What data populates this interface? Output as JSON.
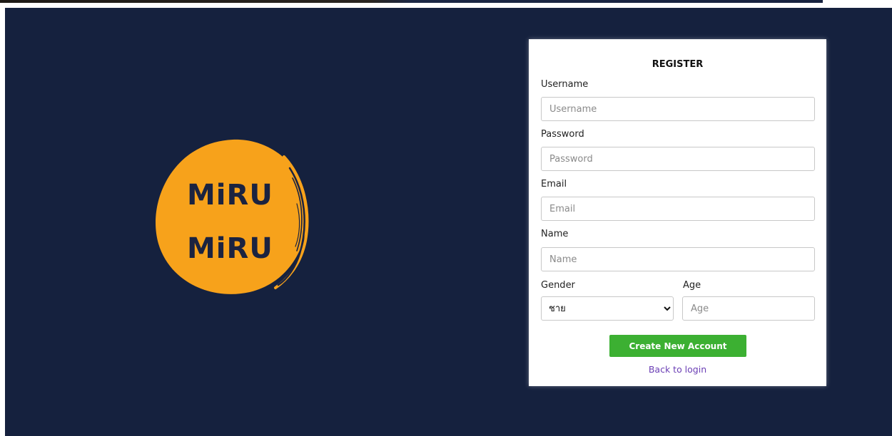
{
  "logo": {
    "line1": "MiRU",
    "line2": "MiRU",
    "color": "#f7a21b",
    "text_color": "#1b2340"
  },
  "form": {
    "title": "REGISTER",
    "username": {
      "label": "Username",
      "placeholder": "Username",
      "value": ""
    },
    "password": {
      "label": "Password",
      "placeholder": "Password",
      "value": ""
    },
    "email": {
      "label": "Email",
      "placeholder": "Email",
      "value": ""
    },
    "name": {
      "label": "Name",
      "placeholder": "Name",
      "value": ""
    },
    "gender": {
      "label": "Gender",
      "selected": "ชาย"
    },
    "age": {
      "label": "Age",
      "placeholder": "Age",
      "value": ""
    },
    "submit_label": "Create New Account",
    "back_link": "Back to login"
  },
  "colors": {
    "background": "#15213e",
    "card": "#ffffff",
    "button": "#3cb032",
    "link": "#6b3fb5"
  }
}
